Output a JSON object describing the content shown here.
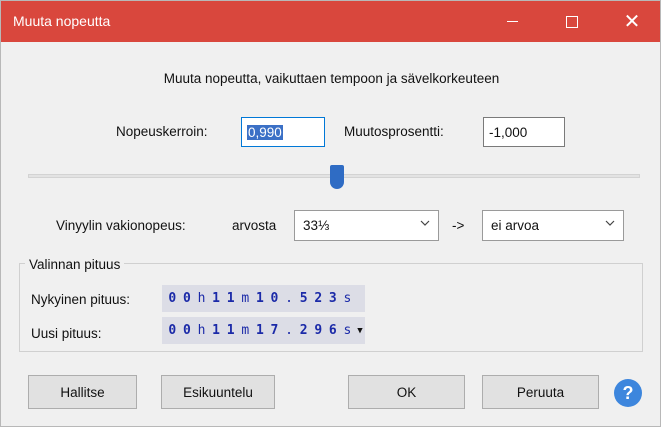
{
  "window": {
    "title": "Muuta nopeutta",
    "accent_color": "#d9473d"
  },
  "description": "Muuta nopeutta, vaikuttaen tempoon ja sävelkorkeuteen",
  "speed": {
    "multiplier_label": "Nopeuskerroin:",
    "multiplier_value": "0,990",
    "percent_label": "Muutosprosentti:",
    "percent_value": "-1,000",
    "slider_level_fraction": 0.51
  },
  "vinyl": {
    "label": "Vinyylin vakionopeus:",
    "from_label": "arvosta",
    "from_value": "33⅓",
    "arrow": "->",
    "to_value": "ei arvoa"
  },
  "selection": {
    "group_title": "Valinnan pituus",
    "current_label": "Nykyinen pituus:",
    "current_chars": [
      "0",
      "0",
      "h",
      "1",
      "1",
      "m",
      "1",
      "0",
      ".",
      "5",
      "2",
      "3",
      "s"
    ],
    "new_label": "Uusi pituus:",
    "new_chars": [
      "0",
      "0",
      "h",
      "1",
      "1",
      "m",
      "1",
      "7",
      ".",
      "2",
      "9",
      "6",
      "s"
    ]
  },
  "buttons": {
    "manage": "Hallitse",
    "preview": "Esikuuntelu",
    "ok": "OK",
    "cancel": "Peruuta",
    "help": "?"
  }
}
